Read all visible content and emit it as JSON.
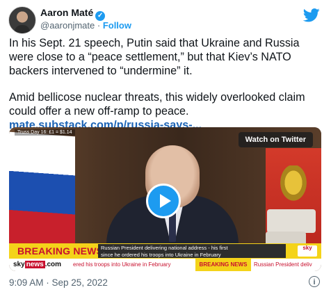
{
  "author": {
    "name": "Aaron Maté",
    "handle": "@aaronjmate",
    "separator": " · ",
    "follow_label": "Follow",
    "verified_icon": "verified-badge-icon"
  },
  "brand_icon": "twitter-bird-icon",
  "tweet": {
    "paragraph1": "In his Sept. 21 speech, Putin said that Ukraine and Russia\nwere close to a “peace settlement,” but that Kiev’s NATO\nbackers intervened to “undermine” it.",
    "paragraph2": "Amid bellicose nuclear threats, this widely overlooked claim\ncould offer a new off-ramp to peace.",
    "link": "mate.substack.com/p/russia-says-..."
  },
  "video": {
    "top_ticker": "Truss Day 16: £1 = $1.14",
    "watch_button": "Watch on Twitter",
    "breaking_label": "BREAKING NEWS",
    "headline": "Russian President delivering national address - his first\nsince he ordered his troops into Ukraine in February",
    "channel_logo": "sky",
    "bottom_brand_sky": "sky",
    "bottom_brand_news": "news",
    "bottom_brand_com": ".com",
    "bottom_ticker_1": "ered his troops into Ukraine in February",
    "bottom_ticker_breaking": "BREAKING NEWS",
    "bottom_ticker_2": "Russian President deliv"
  },
  "footer": {
    "timestamp": "9:09 AM · Sep 25, 2022",
    "info_icon": "info-icon"
  },
  "colors": {
    "accent": "#1d9bf0",
    "breaking_yellow": "#f4d31a",
    "breaking_red": "#c8102e",
    "text": "#0f1419",
    "muted": "#536471"
  }
}
